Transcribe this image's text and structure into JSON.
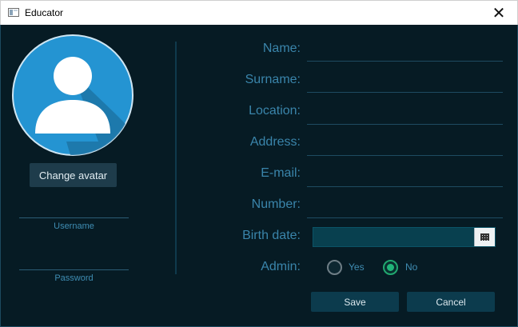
{
  "window": {
    "title": "Educator",
    "close_glyph": "✕",
    "app_icon": "window-app-icon"
  },
  "left_panel": {
    "avatar_icon": "user-avatar-icon",
    "change_avatar_label": "Change avatar",
    "username_label": "Username",
    "password_label": "Password"
  },
  "form": {
    "name_label": "Name:",
    "surname_label": "Surname:",
    "location_label": "Location:",
    "address_label": "Address:",
    "email_label": "E-mail:",
    "number_label": "Number:",
    "birth_date_label": "Birth date:",
    "birth_date_value": "",
    "admin_label": "Admin:",
    "admin_options": [
      {
        "label": "Yes",
        "selected": false
      },
      {
        "label": "No",
        "selected": true
      }
    ]
  },
  "actions": {
    "save_label": "Save",
    "cancel_label": "Cancel"
  },
  "colors": {
    "background": "#061b24",
    "label_text": "#3a85ab",
    "avatar_blue": "#2494d2",
    "radio_selected": "#21b579",
    "button": "#0c3b4d"
  }
}
